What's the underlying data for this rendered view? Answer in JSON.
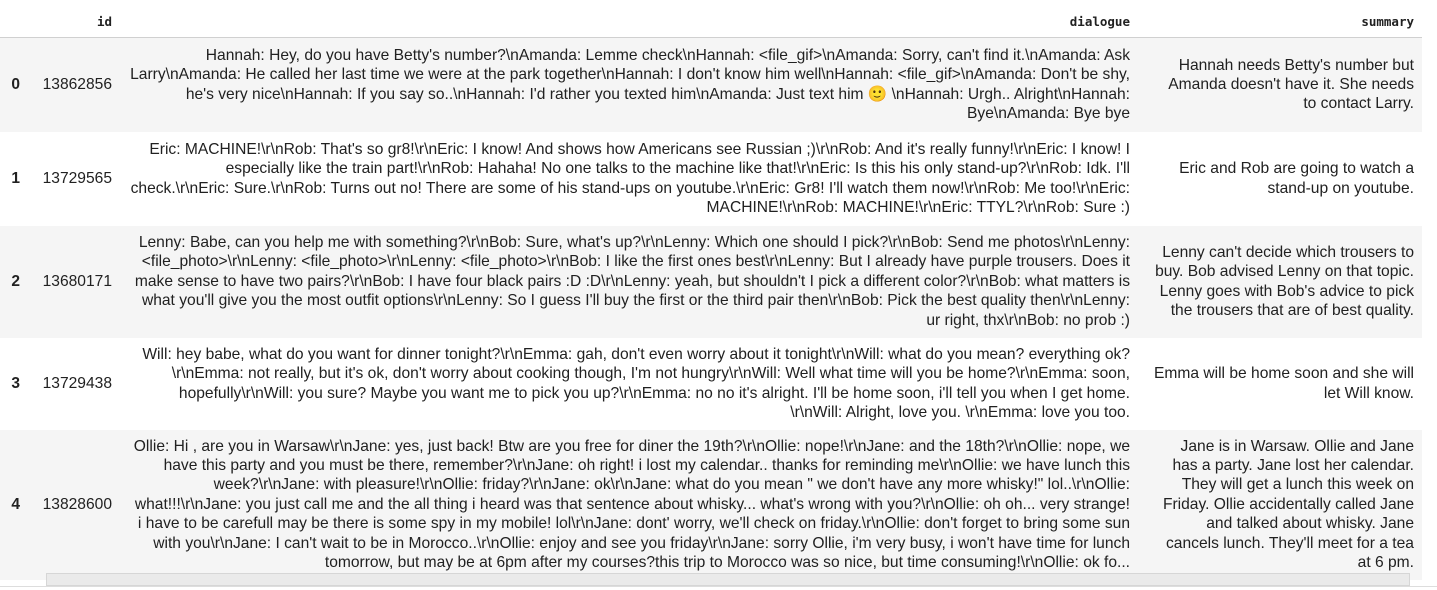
{
  "columns": {
    "index": "",
    "id": "id",
    "dialogue": "dialogue",
    "summary": "summary"
  },
  "rows": [
    {
      "index": "0",
      "id": "13862856",
      "dialogue": "Hannah: Hey, do you have Betty's number?\\nAmanda: Lemme check\\nHannah: <file_gif>\\nAmanda: Sorry, can't find it.\\nAmanda: Ask Larry\\nAmanda: He called her last time we were at the park together\\nHannah: I don't know him well\\nHannah: <file_gif>\\nAmanda: Don't be shy, he's very nice\\nHannah: If you say so..\\nHannah: I'd rather you texted him\\nAmanda: Just text him 🙂 \\nHannah: Urgh.. Alright\\nHannah: Bye\\nAmanda: Bye bye",
      "summary": "Hannah needs Betty's number but Amanda doesn't have it. She needs to contact Larry."
    },
    {
      "index": "1",
      "id": "13729565",
      "dialogue": "Eric: MACHINE!\\r\\nRob: That's so gr8!\\r\\nEric: I know! And shows how Americans see Russian ;)\\r\\nRob: And it's really funny!\\r\\nEric: I know! I especially like the train part!\\r\\nRob: Hahaha! No one talks to the machine like that!\\r\\nEric: Is this his only stand-up?\\r\\nRob: Idk. I'll check.\\r\\nEric: Sure.\\r\\nRob: Turns out no! There are some of his stand-ups on youtube.\\r\\nEric: Gr8! I'll watch them now!\\r\\nRob: Me too!\\r\\nEric: MACHINE!\\r\\nRob: MACHINE!\\r\\nEric: TTYL?\\r\\nRob: Sure :)",
      "summary": "Eric and Rob are going to watch a stand-up on youtube."
    },
    {
      "index": "2",
      "id": "13680171",
      "dialogue": "Lenny: Babe, can you help me with something?\\r\\nBob: Sure, what's up?\\r\\nLenny: Which one should I pick?\\r\\nBob: Send me photos\\r\\nLenny: <file_photo>\\r\\nLenny: <file_photo>\\r\\nLenny: <file_photo>\\r\\nBob: I like the first ones best\\r\\nLenny: But I already have purple trousers. Does it make sense to have two pairs?\\r\\nBob: I have four black pairs :D :D\\r\\nLenny: yeah, but shouldn't I pick a different color?\\r\\nBob: what matters is what you'll give you the most outfit options\\r\\nLenny: So I guess I'll buy the first or the third pair then\\r\\nBob: Pick the best quality then\\r\\nLenny: ur right, thx\\r\\nBob: no prob :)",
      "summary": "Lenny can't decide which trousers to buy. Bob advised Lenny on that topic. Lenny goes with Bob's advice to pick the trousers that are of best quality."
    },
    {
      "index": "3",
      "id": "13729438",
      "dialogue": "Will: hey babe, what do you want for dinner tonight?\\r\\nEmma: gah, don't even worry about it tonight\\r\\nWill: what do you mean? everything ok?\\r\\nEmma: not really, but it's ok, don't worry about cooking though, I'm not hungry\\r\\nWill: Well what time will you be home?\\r\\nEmma: soon, hopefully\\r\\nWill: you sure? Maybe you want me to pick you up?\\r\\nEmma: no no it's alright. I'll be home soon, i'll tell you when I get home. \\r\\nWill: Alright, love you. \\r\\nEmma: love you too.",
      "summary": "Emma will be home soon and she will let Will know."
    },
    {
      "index": "4",
      "id": "13828600",
      "dialogue": "Ollie: Hi , are you in Warsaw\\r\\nJane: yes, just back! Btw are you free for diner the 19th?\\r\\nOllie: nope!\\r\\nJane: and the 18th?\\r\\nOllie: nope, we have this party and you must be there, remember?\\r\\nJane: oh right! i lost my calendar.. thanks for reminding me\\r\\nOllie: we have lunch this week?\\r\\nJane: with pleasure!\\r\\nOllie: friday?\\r\\nJane: ok\\r\\nJane: what do you mean \" we don't have any more whisky!\" lol..\\r\\nOllie: what!!!\\r\\nJane: you just call me and the all thing i heard was that sentence about whisky... what's wrong with you?\\r\\nOllie: oh oh... very strange! i have to be carefull may be there is some spy in my mobile! lol\\r\\nJane: dont' worry, we'll check on friday.\\r\\nOllie: don't forget to bring some sun with you\\r\\nJane: I can't wait to be in Morocco..\\r\\nOllie: enjoy and see you friday\\r\\nJane: sorry Ollie, i'm very busy, i won't have time for lunch tomorrow, but may be at 6pm after my courses?this trip to Morocco was so nice, but time consuming!\\r\\nOllie: ok fo...",
      "summary": "Jane is in Warsaw. Ollie and Jane has a party. Jane lost her calendar. They will get a lunch this week on Friday. Ollie accidentally called Jane and talked about whisky. Jane cancels lunch. They'll meet for a tea at 6 pm."
    }
  ]
}
